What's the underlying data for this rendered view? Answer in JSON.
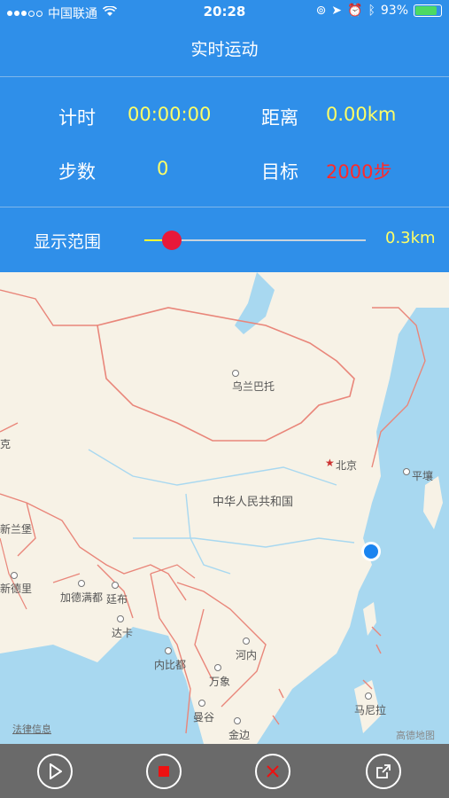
{
  "status_bar": {
    "carrier": "中国联通",
    "time": "20:28",
    "battery": "93%",
    "battery_level": 0.93
  },
  "header": {
    "title": "实时运动"
  },
  "stats": {
    "time_label": "计时",
    "time_value": "00:00:00",
    "distance_label": "距离",
    "distance_value": "0.00km",
    "steps_label": "步数",
    "steps_value": "0",
    "goal_label": "目标",
    "goal_value": "2000步"
  },
  "range": {
    "label": "显示范围",
    "value": "0.3km",
    "slider_fraction": 0.125
  },
  "map": {
    "places": [
      "乌兰巴托",
      "北京",
      "平壤",
      "中华人民共和国",
      "新兰堡",
      "新德里",
      "加德满都",
      "廷布",
      "达卡",
      "内比都",
      "河内",
      "万象",
      "曼谷",
      "金边",
      "马尼拉",
      "克"
    ],
    "legal": "法律信息",
    "brand": "高德地图"
  },
  "toolbar": {
    "icons": [
      "play-icon",
      "stop-icon",
      "close-icon",
      "share-icon"
    ]
  },
  "colors": {
    "header_bg": "#2f8fe9",
    "highlight": "#ffff66",
    "goal": "#ff2a2a",
    "slider_thumb": "#e8183a",
    "toolbar_bg": "#6a6a6a"
  }
}
